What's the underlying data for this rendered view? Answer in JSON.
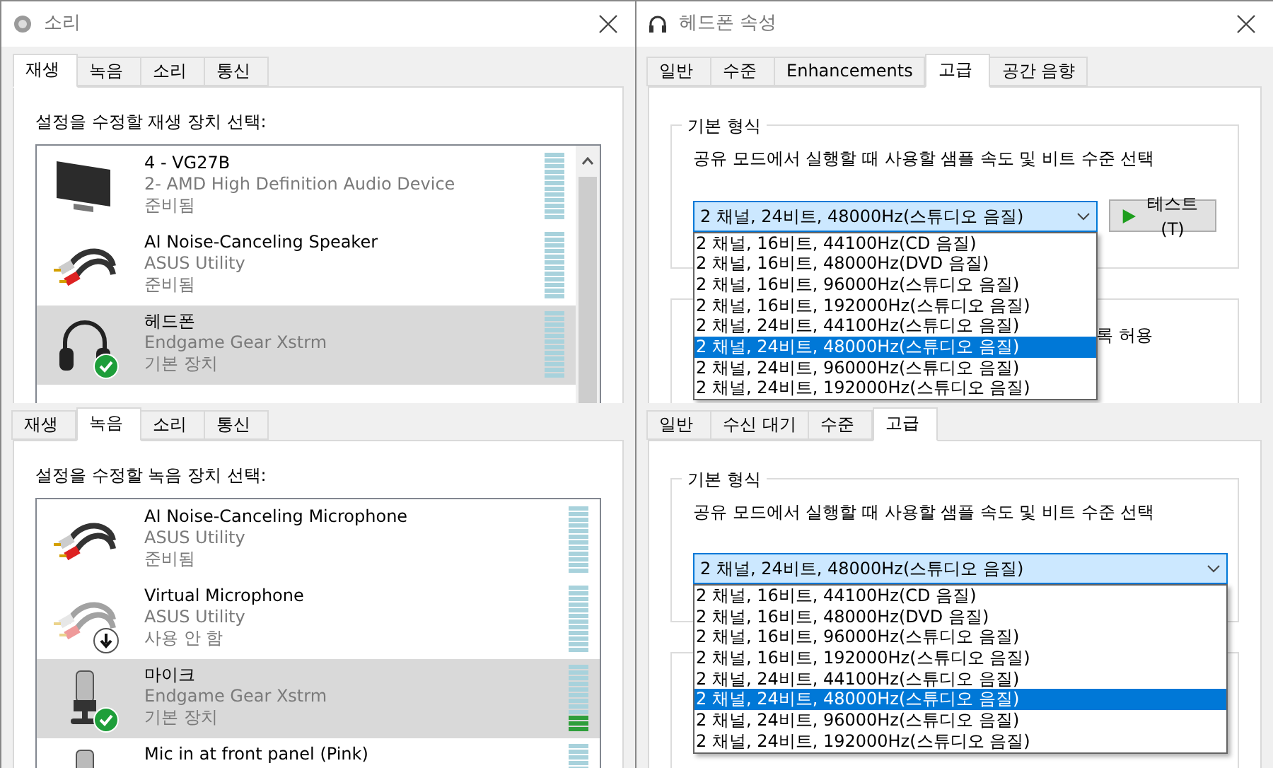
{
  "playback_window": {
    "title": "소리",
    "tabs": [
      {
        "label": "재생",
        "selected": true
      },
      {
        "label": "녹음",
        "selected": false
      },
      {
        "label": "소리",
        "selected": false
      },
      {
        "label": "통신",
        "selected": false
      }
    ],
    "prompt": "설정을 수정할 재생 장치 선택:",
    "devices": [
      {
        "kind": "monitor",
        "name": "4 - VG27B",
        "description": "2- AMD High Definition Audio Device",
        "status": "준비됨",
        "default_device": false,
        "disabled": false,
        "selected": false
      },
      {
        "kind": "cable",
        "name": "AI Noise-Canceling Speaker",
        "description": "ASUS Utility",
        "status": "준비됨",
        "default_device": false,
        "disabled": false,
        "selected": false
      },
      {
        "kind": "headphones",
        "name": "헤드폰",
        "description": "Endgame Gear Xstrm",
        "status": "기본 장치",
        "default_device": true,
        "disabled": false,
        "selected": true
      }
    ]
  },
  "recording_panel": {
    "tabs": [
      {
        "label": "재생",
        "selected": false
      },
      {
        "label": "녹음",
        "selected": true
      },
      {
        "label": "소리",
        "selected": false
      },
      {
        "label": "통신",
        "selected": false
      }
    ],
    "prompt": "설정을 수정할 녹음 장치 선택:",
    "devices": [
      {
        "kind": "cable",
        "name": "AI Noise-Canceling Microphone",
        "description": "ASUS Utility",
        "status": "준비됨",
        "default_device": false,
        "disabled": false,
        "selected": false
      },
      {
        "kind": "cable",
        "name": "Virtual Microphone",
        "description": "ASUS Utility",
        "status": "사용 안 함",
        "default_device": false,
        "disabled": true,
        "selected": false
      },
      {
        "kind": "microphone",
        "name": "마이크",
        "description": "Endgame Gear Xstrm",
        "status": "기본 장치",
        "default_device": true,
        "disabled": false,
        "selected": true,
        "level": 0.25
      },
      {
        "kind": "microphone",
        "name": "Mic in at front panel (Pink)",
        "default_device": false,
        "disabled": false,
        "selected": false
      }
    ]
  },
  "properties_window": {
    "title": "헤드폰 속성",
    "tabs": [
      {
        "label": "일반",
        "selected": false
      },
      {
        "label": "수준",
        "selected": false
      },
      {
        "label": "Enhancements",
        "selected": false
      },
      {
        "label": "고급",
        "selected": true
      },
      {
        "label": "공간 음향",
        "selected": false
      }
    ],
    "group_label": "기본 형식",
    "description": "공유 모드에서 실행할 때 사용할 샘플 속도 및 비트 수준 선택",
    "format_select": {
      "value": "2 채널, 24비트, 48000Hz(스튜디오 음질)",
      "options": [
        {
          "label": "2 채널, 16비트, 44100Hz(CD 음질)",
          "selected": false
        },
        {
          "label": "2 채널, 16비트, 48000Hz(DVD 음질)",
          "selected": false
        },
        {
          "label": "2 채널, 16비트, 96000Hz(스튜디오 음질)",
          "selected": false
        },
        {
          "label": "2 채널, 16비트, 192000Hz(스튜디오 음질)",
          "selected": false
        },
        {
          "label": "2 채널, 24비트, 44100Hz(스튜디오 음질)",
          "selected": false
        },
        {
          "label": "2 채널, 24비트, 48000Hz(스튜디오 음질)",
          "selected": true
        },
        {
          "label": "2 채널, 24비트, 96000Hz(스튜디오 음질)",
          "selected": false
        },
        {
          "label": "2 채널, 24비트, 192000Hz(스튜디오 음질)",
          "selected": false
        }
      ]
    },
    "test_button": "테스트(T)",
    "partial_text": "록 허용"
  },
  "properties_panel_2": {
    "tabs": [
      {
        "label": "일반",
        "selected": false
      },
      {
        "label": "수신 대기",
        "selected": false
      },
      {
        "label": "수준",
        "selected": false
      },
      {
        "label": "고급",
        "selected": true
      }
    ],
    "group_label": "기본 형식",
    "description": "공유 모드에서 실행할 때 사용할 샘플 속도 및 비트 수준 선택",
    "format_select": {
      "value": "2 채널, 24비트, 48000Hz(스튜디오 음질)",
      "options": [
        {
          "label": "2 채널, 16비트, 44100Hz(CD 음질)",
          "selected": false
        },
        {
          "label": "2 채널, 16비트, 48000Hz(DVD 음질)",
          "selected": false
        },
        {
          "label": "2 채널, 16비트, 96000Hz(스튜디오 음질)",
          "selected": false
        },
        {
          "label": "2 채널, 16비트, 192000Hz(스튜디오 음질)",
          "selected": false
        },
        {
          "label": "2 채널, 24비트, 44100Hz(스튜디오 음질)",
          "selected": false
        },
        {
          "label": "2 채널, 24비트, 48000Hz(스튜디오 음질)",
          "selected": true
        },
        {
          "label": "2 채널, 24비트, 96000Hz(스튜디오 음질)",
          "selected": false
        },
        {
          "label": "2 채널, 24비트, 192000Hz(스튜디오 음질)",
          "selected": false
        }
      ]
    }
  }
}
